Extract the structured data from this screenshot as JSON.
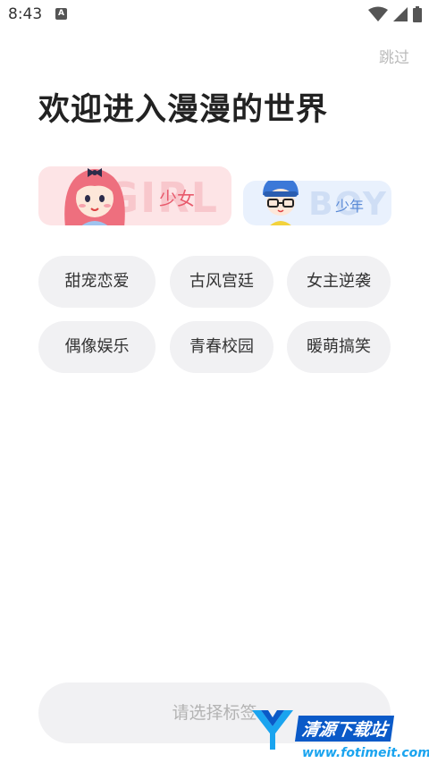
{
  "status_bar": {
    "time": "8:43",
    "notif_icon_letter": "A",
    "icons": [
      "wifi-icon",
      "cell-signal-icon",
      "battery-icon"
    ]
  },
  "header": {
    "skip_label": "跳过",
    "title": "欢迎进入漫漫的世界"
  },
  "gender": {
    "girl": {
      "label": "少女",
      "watermark": "GIRL",
      "color": "#e85a6c"
    },
    "boy": {
      "label": "少年",
      "watermark": "BOY",
      "color": "#5a8ad6"
    }
  },
  "tags": [
    "甜宠恋爱",
    "古风宫廷",
    "女主逆袭",
    "偶像娱乐",
    "青春校园",
    "暖萌搞笑"
  ],
  "footer": {
    "submit_label": "请选择标签"
  },
  "watermark": {
    "brand": "清源下载站",
    "url": "www.fotimeit.com"
  }
}
